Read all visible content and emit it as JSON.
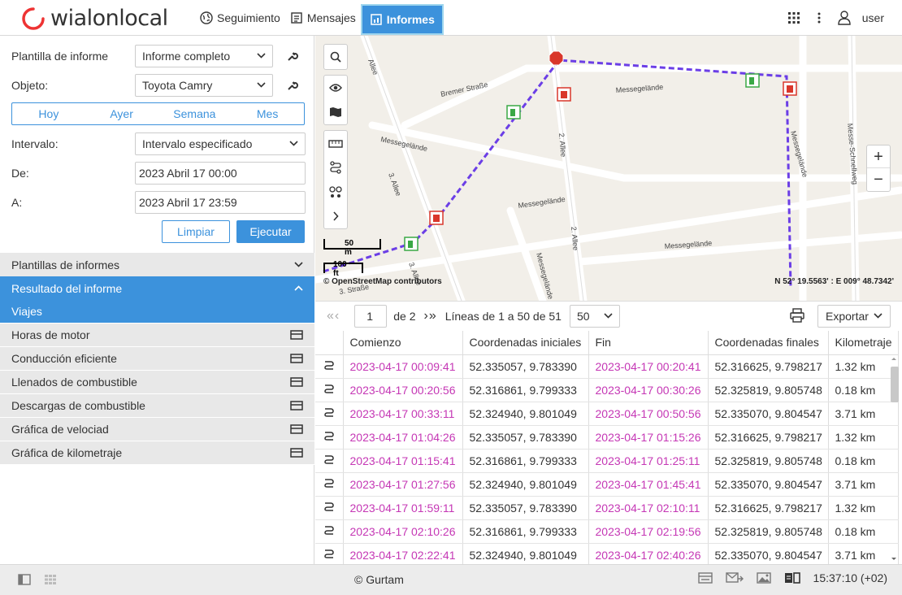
{
  "app": {
    "logo_text_a": "wialon",
    "logo_text_b": "local"
  },
  "nav": {
    "items": [
      {
        "label": "Seguimiento",
        "icon": "globe-icon"
      },
      {
        "label": "Mensajes",
        "icon": "messages-icon"
      },
      {
        "label": "Informes",
        "icon": "reports-icon",
        "active": true
      }
    ],
    "user": "user"
  },
  "form": {
    "template_label": "Plantilla de informe",
    "template_value": "Informe completo",
    "object_label": "Objeto:",
    "object_value": "Toyota Camry",
    "periods": [
      "Hoy",
      "Ayer",
      "Semana",
      "Mes"
    ],
    "interval_label": "Intervalo:",
    "interval_value": "Intervalo especificado",
    "from_label": "De:",
    "from_value": "2023 Abril 17 00:00",
    "to_label": "A:",
    "to_value": "2023 Abril 17 23:59",
    "clear_label": "Limpiar",
    "execute_label": "Ejecutar"
  },
  "sections": {
    "templates_label": "Plantillas de informes",
    "result_label": "Resultado del informe",
    "items": [
      {
        "label": "Viajes",
        "selected": true
      },
      {
        "label": "Horas de motor"
      },
      {
        "label": "Conducción eficiente"
      },
      {
        "label": "Llenados de combustible"
      },
      {
        "label": "Descargas de combustible"
      },
      {
        "label": "Gráfica de velociad"
      },
      {
        "label": "Gráfica de kilometraje"
      }
    ]
  },
  "map": {
    "streets": [
      "Bremer Straße",
      "Messegelände",
      "Messegelände",
      "Messegelände",
      "Messegelände",
      "2. Allee",
      "2. Allee",
      "3. Allee",
      "3. Allee",
      "3. Straße",
      "Messe-Schnellweg",
      "Allee",
      "Messegelände",
      "Messegelände"
    ],
    "scale_m": "50 m",
    "scale_ft": "100 ft",
    "attribution": "© OpenStreetMap contributors",
    "coordinates": "N 52° 19.5563' : E 009° 48.7342'",
    "zoom_in": "+",
    "zoom_out": "−"
  },
  "table": {
    "page": "1",
    "of_pages": "de 2",
    "lines_info": "Líneas de 1 a 50 de 51",
    "per_page": "50",
    "export_label": "Exportar",
    "columns": [
      "Comienzo",
      "Coordenadas iniciales",
      "Fin",
      "Coordenadas finales",
      "Kilometraje"
    ],
    "rows": [
      [
        "2023-04-17 00:09:41",
        "52.335057, 9.783390",
        "2023-04-17 00:20:41",
        "52.316625, 9.798217",
        "1.32 km"
      ],
      [
        "2023-04-17 00:20:56",
        "52.316861, 9.799333",
        "2023-04-17 00:30:26",
        "52.325819, 9.805748",
        "0.18 km"
      ],
      [
        "2023-04-17 00:33:11",
        "52.324940, 9.801049",
        "2023-04-17 00:50:56",
        "52.335070, 9.804547",
        "3.71 km"
      ],
      [
        "2023-04-17 01:04:26",
        "52.335057, 9.783390",
        "2023-04-17 01:15:26",
        "52.316625, 9.798217",
        "1.32 km"
      ],
      [
        "2023-04-17 01:15:41",
        "52.316861, 9.799333",
        "2023-04-17 01:25:11",
        "52.325819, 9.805748",
        "0.18 km"
      ],
      [
        "2023-04-17 01:27:56",
        "52.324940, 9.801049",
        "2023-04-17 01:45:41",
        "52.335070, 9.804547",
        "3.71 km"
      ],
      [
        "2023-04-17 01:59:11",
        "52.335057, 9.783390",
        "2023-04-17 02:10:11",
        "52.316625, 9.798217",
        "1.32 km"
      ],
      [
        "2023-04-17 02:10:26",
        "52.316861, 9.799333",
        "2023-04-17 02:19:56",
        "52.325819, 9.805748",
        "0.18 km"
      ],
      [
        "2023-04-17 02:22:41",
        "52.324940, 9.801049",
        "2023-04-17 02:40:26",
        "52.335070, 9.804547",
        "3.71 km"
      ]
    ]
  },
  "footer": {
    "copyright": "© Gurtam",
    "time": "15:37:10 (+02)"
  },
  "colors": {
    "accent": "#3c92dc",
    "time_text": "#c537b5",
    "track": "#6b3ee6",
    "fuel_fill": "#3aa845",
    "fuel_drain": "#d9372b",
    "stop": "#d9372b"
  }
}
